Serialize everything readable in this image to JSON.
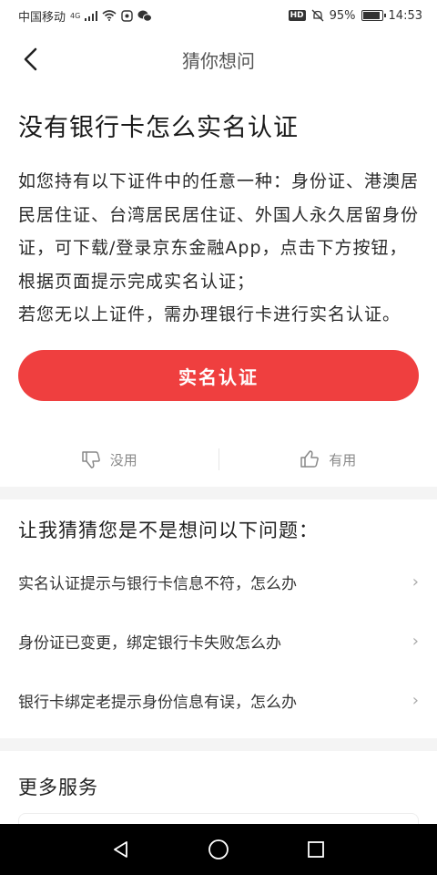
{
  "status_bar": {
    "carrier": "中国移动",
    "network": "4G",
    "hd": "HD",
    "battery_percent": "95%",
    "time": "14:53"
  },
  "nav": {
    "title": "猜你想问"
  },
  "article": {
    "title": "没有银行卡怎么实名认证",
    "paragraph1": "如您持有以下证件中的任意一种：身份证、港澳居民居住证、台湾居民居住证、外国人永久居留身份证，可下载/登录京东金融App，点击下方按钮，根据页面提示完成实名认证；",
    "paragraph2": "若您无以上证件，需办理银行卡进行实名认证。"
  },
  "primary_button": {
    "label": "实名认证",
    "color": "#ef3f3f"
  },
  "feedback": {
    "useless_label": "没用",
    "useful_label": "有用"
  },
  "suggestions": {
    "heading": "让我猜猜您是不是想问以下问题：",
    "items": [
      {
        "label": "实名认证提示与银行卡信息不符，怎么办"
      },
      {
        "label": "身份证已变更，绑定银行卡失败怎么办"
      },
      {
        "label": "银行卡绑定老提示身份信息有误，怎么办"
      }
    ]
  },
  "more": {
    "heading": "更多服务"
  }
}
